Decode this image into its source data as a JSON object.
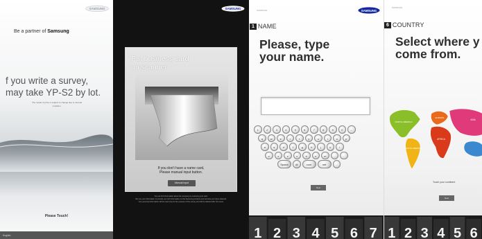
{
  "brand": "SAMSUNG",
  "panel1": {
    "partner_prefix": "Be a partner of ",
    "partner_brand": "Samsung",
    "headline_line1": "f you write a survey,",
    "headline_line2": "may take YP-S2 by lot.",
    "fine_print": "The model of prize is subject to change due to internal condition.",
    "touch_label": "Please Touch!",
    "footer": "English"
  },
  "panel2": {
    "title_line1": "Put business card",
    "title_line2": "on scanner",
    "message_line1": "If you don't have a name card,",
    "message_line2": "Please manual input button.",
    "button_label": "Manual input",
    "legal_line1": "You can find information about the company by scanning your card.",
    "legal_line2": "We use your information to provide you with information on the Samsung products and services you have selected.",
    "legal_line3": "Your personal information will be used only for the purpose of the survey and will be deleted after the event."
  },
  "panel3": {
    "tiny_brand": "SAMSUNG",
    "step_number": "1",
    "step_label": "NAME",
    "question_line1": "Please, type",
    "question_line2": "your name.",
    "input_value": "",
    "keyboard_rows": [
      [
        "1",
        "2",
        "3",
        "4",
        "5",
        "6",
        "7",
        "8",
        "9",
        "0",
        "←"
      ],
      [
        "q",
        "w",
        "e",
        "r",
        "t",
        "y",
        "u",
        "i",
        "o",
        "p"
      ],
      [
        "a",
        "s",
        "d",
        "f",
        "g",
        "h",
        "j",
        "k",
        "l"
      ],
      [
        "z",
        "x",
        "c",
        "v",
        "b",
        "n",
        "m",
        ",",
        "."
      ],
      [
        "Space",
        "@",
        "com",
        "net",
        "."
      ]
    ],
    "next_label": "Next",
    "progress_digits": "1 2 3 4 5 6 7"
  },
  "panel4": {
    "tiny_brand": "SAMSUNG",
    "step_number": "6",
    "step_label": "COUNTRY",
    "question_line1": "Select where y",
    "question_line2": "come from.",
    "touch_continent": "Touch your continent",
    "continents": [
      "NORTH AMERICA",
      "SOUTH AMERICA",
      "EUROPE",
      "AFRICA",
      "ASIA"
    ],
    "next_label": "Next",
    "progress_digits": "1 2 3 4 5 6"
  },
  "colors": {
    "samsung_blue": "#1428a0",
    "north_america": "#8bbf2a",
    "south_america": "#f0b416",
    "europe": "#e86a1a",
    "africa": "#d83a1a",
    "asia": "#e03a7a",
    "oceania": "#3b88d0"
  }
}
